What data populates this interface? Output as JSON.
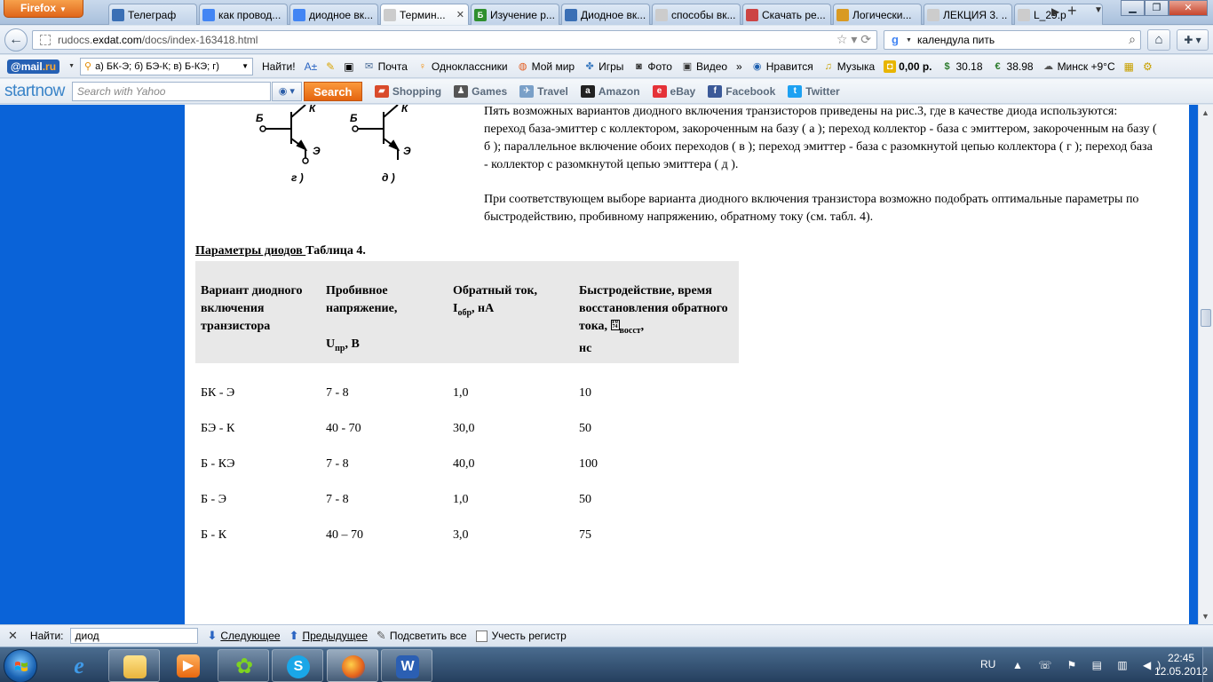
{
  "browser": {
    "app_button": "Firefox",
    "tabs": [
      {
        "label": "Телеграф",
        "icon_color": "#3a6fb5"
      },
      {
        "label": "как провод...",
        "icon_color": "#4285f4"
      },
      {
        "label": "диодное вк...",
        "icon_color": "#4285f4"
      },
      {
        "label": "Термин...",
        "icon_color": "#cccccc",
        "active": true
      },
      {
        "label": "Изучение р...",
        "icon_color": "#2f8f2f",
        "icon_letter": "Б"
      },
      {
        "label": "Диодное вк...",
        "icon_color": "#3a6fb5"
      },
      {
        "label": "способы вк...",
        "icon_color": "#cccccc"
      },
      {
        "label": "Скачать ре...",
        "icon_color": "#c44"
      },
      {
        "label": "Логически...",
        "icon_color": "#d99a22"
      },
      {
        "label": "ЛЕКЦИЯ 3. ...",
        "icon_color": "#cccccc"
      },
      {
        "label": "L_29.p",
        "icon_color": "#cccccc"
      }
    ],
    "url": {
      "prefix": "rudocs.",
      "domain": "exdat.com",
      "path": "/docs/index-163418.html"
    },
    "search_query": "календула пить"
  },
  "mailru": {
    "logo_at": "@mail",
    "logo_tld": ".ru",
    "search_value": "а) БК-Э; б) БЭ-К; в) Б-КЭ; г)",
    "find_button": "Найти!",
    "links": [
      {
        "label": "Почта",
        "icon": "mail-icon"
      },
      {
        "label": "Одноклассники",
        "icon": "odnoklassniki-icon"
      },
      {
        "label": "Мой мир",
        "icon": "my-world-icon"
      },
      {
        "label": "Игры",
        "icon": "games-icon"
      },
      {
        "label": "Фото",
        "icon": "camera-icon"
      },
      {
        "label": "Видео",
        "icon": "video-icon"
      }
    ],
    "more": "»",
    "likes": "Нравится",
    "music": "Музыка",
    "balance": "0,00 р.",
    "usd": "30.18",
    "eur": "38.98",
    "weather": "Минск +9°C"
  },
  "startnow": {
    "logo": "startnow",
    "search_placeholder": "Search with Yahoo",
    "search_button": "Search",
    "links": [
      "Shopping",
      "Games",
      "Travel",
      "Amazon",
      "eBay",
      "Facebook",
      "Twitter"
    ]
  },
  "document": {
    "diagram": {
      "base_label": "Б",
      "emitter_label": "Э",
      "collector_label": "К",
      "captions": [
        "г )",
        "д )"
      ]
    },
    "para1": "Пять возможных вариантов диодного включения транзисторов приведены на рис.3, где в качестве диода используются: переход база-эмиттер с коллектором, закороченным на базу ( а ); переход коллектор - база с эмиттером, закороченным на базу ( б ); параллельное включение обоих переходов ( в ); переход эмиттер - база с разомкнутой цепью коллектора ( г ); переход база - коллектор с разомкнутой цепью эмиттера ( д ).",
    "para2": "При соответствующем выборе варианта диодного включения транзистора возможно подобрать оптимальные параметры по быстродействию, пробивному напряжению, обратному току (см. табл. 4).",
    "table_caption_underlined": "Параметры диодов ",
    "table_caption_rest": "Таблица 4.",
    "table": {
      "headers": {
        "col1": "Вариант диодного включения транзистора",
        "col2_line1": "Пробивное напряжение,",
        "col2_symbol": "U",
        "col2_sub": "пр",
        "col2_unit": ", В",
        "col3_line1": "Обратный ток,",
        "col3_symbol": "I",
        "col3_sub": "обр",
        "col3_unit": ", нА",
        "col4_line1": "Быстродействие, время восстановления обратного тока,",
        "col4_sub": "восст",
        "col4_unit": ",",
        "col4_line2": "нс"
      },
      "rows": [
        [
          "БК - Э",
          "7 - 8",
          "1,0",
          "10"
        ],
        [
          "БЭ - К",
          "40 - 70",
          "30,0",
          "50"
        ],
        [
          "Б - КЭ",
          "7 - 8",
          "40,0",
          "100"
        ],
        [
          "Б - Э",
          "7 - 8",
          "1,0",
          "50"
        ],
        [
          "Б - К",
          "40 – 70",
          "3,0",
          "75"
        ]
      ]
    }
  },
  "findbar": {
    "label": "Найти:",
    "value": "диод",
    "next": "Следующее",
    "prev": "Предыдущее",
    "highlight": "Подсветить все",
    "match_case": "Учесть регистр"
  },
  "taskbar": {
    "lang": "RU",
    "time": "22:45",
    "date": "12.05.2012"
  }
}
